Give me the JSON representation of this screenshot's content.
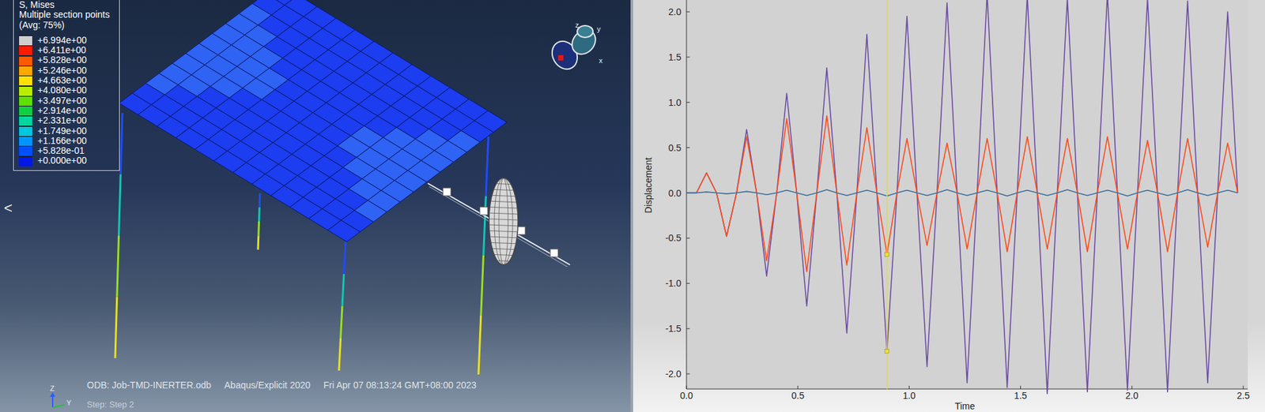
{
  "viewport": {
    "legend": {
      "title_lines": [
        "S, Mises",
        "Multiple section points",
        "(Avg: 75%)"
      ],
      "entries": [
        {
          "value": "+6.994e+00",
          "color": "#cfcfcf"
        },
        {
          "value": "+6.411e+00",
          "color": "#ff1a00"
        },
        {
          "value": "+5.828e+00",
          "color": "#ff5a00"
        },
        {
          "value": "+5.246e+00",
          "color": "#ffa800"
        },
        {
          "value": "+4.663e+00",
          "color": "#ffe000"
        },
        {
          "value": "+4.080e+00",
          "color": "#b8ef00"
        },
        {
          "value": "+3.497e+00",
          "color": "#5ee000"
        },
        {
          "value": "+2.914e+00",
          "color": "#10d040"
        },
        {
          "value": "+2.331e+00",
          "color": "#00d5a0"
        },
        {
          "value": "+1.749e+00",
          "color": "#00c8e0"
        },
        {
          "value": "+1.166e+00",
          "color": "#0096ff"
        },
        {
          "value": "+5.828e-01",
          "color": "#0050ff"
        },
        {
          "value": "+0.000e+00",
          "color": "#0018e8"
        }
      ]
    },
    "info_line": [
      "ODB: Job-TMD-INERTER.odb",
      "Abaqus/Explicit 2020",
      "Fri Apr 07 08:13:24 GMT+08:00 2023"
    ],
    "step": "Step: Step 2",
    "view_triad": [
      "z",
      "y",
      "x"
    ],
    "axis_triad": [
      "Z",
      "Y"
    ],
    "side_arrow": "<"
  },
  "chart": {
    "y_label": "Displacement",
    "x_label": "Time",
    "y_ticks": [
      "2.0",
      "1.5",
      "1.0",
      "0.5",
      "0.0",
      "-0.5",
      "-1.0",
      "-1.5",
      "-2.0"
    ],
    "x_ticks": [
      "0.0",
      "0.5",
      "1.0",
      "1.5",
      "2.0",
      "2.5"
    ],
    "sample_start": 0,
    "sample_step": 0.045,
    "series": [
      {
        "color": "#6b4ea3",
        "values": [
          0,
          0,
          0.22,
          0,
          -0.48,
          0,
          0.7,
          0,
          -0.92,
          0,
          1.1,
          0,
          -1.25,
          0,
          1.38,
          0,
          -1.55,
          0,
          1.75,
          0,
          -1.75,
          0,
          1.95,
          0,
          -1.92,
          0,
          2.1,
          0,
          -2.1,
          0,
          2.2,
          0,
          -2.15,
          0,
          2.18,
          0,
          -2.22,
          0,
          2.15,
          0,
          -2.2,
          0,
          2.2,
          0,
          -2.18,
          0,
          2.15,
          0,
          -2.2,
          0,
          2.12,
          0,
          -2.1,
          0,
          2.0,
          0
        ]
      },
      {
        "color": "#ff4a1a",
        "values": [
          0,
          0,
          0.22,
          0,
          -0.48,
          0,
          0.62,
          0,
          -0.75,
          0,
          0.82,
          0,
          -0.87,
          0,
          0.85,
          0,
          -0.8,
          0,
          0.72,
          0,
          -0.68,
          0,
          0.6,
          0,
          -0.58,
          0,
          0.55,
          0,
          -0.62,
          0,
          0.6,
          0,
          -0.65,
          0,
          0.62,
          0,
          -0.62,
          0,
          0.6,
          0,
          -0.65,
          0,
          0.62,
          0,
          -0.62,
          0,
          0.58,
          0,
          -0.65,
          0,
          0.6,
          0,
          -0.6,
          0,
          0.55,
          0
        ]
      },
      {
        "color": "#3f6f9c",
        "values": [
          0,
          0,
          0.01,
          0,
          -0.01,
          0,
          0.015,
          0,
          -0.02,
          0,
          0.03,
          0,
          -0.03,
          0,
          0.035,
          0,
          -0.03,
          0,
          0.03,
          0,
          -0.035,
          0,
          0.03,
          0,
          -0.03,
          0,
          0.035,
          0,
          -0.03,
          0,
          0.03,
          0,
          -0.035,
          0,
          0.03,
          0,
          -0.03,
          0,
          0.035,
          0,
          -0.03,
          0,
          0.03,
          0,
          -0.035,
          0,
          0.03,
          0,
          -0.03,
          0,
          0.035,
          0,
          -0.03,
          0,
          0.03,
          0
        ]
      }
    ],
    "cursor": {
      "x": 0.9
    }
  }
}
